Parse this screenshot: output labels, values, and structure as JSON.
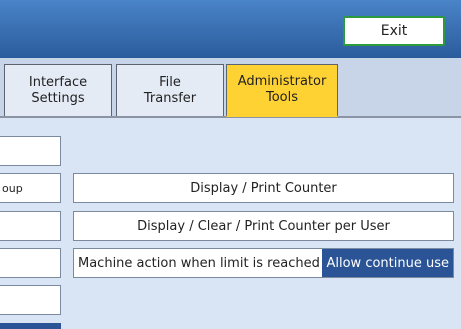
{
  "header": {
    "exit_label": "Exit"
  },
  "tabs": [
    {
      "line1": "Interface",
      "line2": "Settings"
    },
    {
      "line1": "File",
      "line2": "Transfer"
    },
    {
      "line1": "Administrator",
      "line2": "Tools"
    }
  ],
  "left_column": {
    "items": [
      "",
      "oup",
      "",
      "",
      ""
    ]
  },
  "main": {
    "display_print_counter": "Display / Print Counter",
    "display_clear_print_counter_per_user": "Display / Clear / Print Counter per User",
    "machine_action_label": "Machine action when limit is reached",
    "machine_action_value": "Allow continue use"
  },
  "colors": {
    "topbar": "#2a5c9c",
    "active_tab": "#ffd233",
    "panel_bg": "#d9e5f4",
    "selected_value": "#2a5496",
    "exit_border": "#2e9a3e"
  }
}
